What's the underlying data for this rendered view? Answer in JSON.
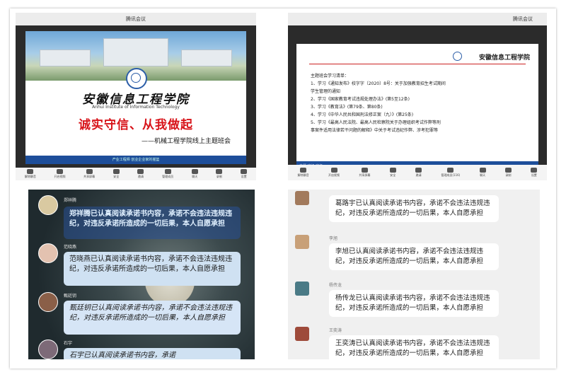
{
  "top_left": {
    "titlebar": "腾讯会议",
    "school_name": "安徽信息工程学院",
    "school_en": "Anhui Institute of Information Technology",
    "headline": "诚实守信、从我做起",
    "subtitle": "——机械工程学院线上主题班会",
    "slide_footer": "产业工程师  创业企业家的摇篮",
    "toolbar": [
      "解除静音",
      "开启视频",
      "共享屏幕",
      "安全",
      "邀请",
      "管理成员",
      "聊天",
      "录制",
      "设置"
    ]
  },
  "top_right": {
    "titlebar": "腾讯会议",
    "doc_header": "安徽信息工程学院",
    "doc_lines": [
      "主题班会学习清单：",
      "1、学习《通知发布》校字字〔2020〕8号：关于加强教育招生考试期间",
      "   学生管理的通知",
      "2、学习《国家教育考试违规处理办法》(第5至12条)",
      "3、学习《教育法》(第79条、第80条)",
      "4、学习《中华人民共和国刑法修正案（九）》(第25条)",
      "5、学习《最高人民法院、最高人民检察院关于办理组织考试作弊等刑",
      "   事案件适用法律若干问题的解释》中关于考试违纪作弊、涉考犯罪等"
    ],
    "doc_footer": "主题  班级  班级",
    "toolbar": [
      "解除静音",
      "开启视频",
      "共享屏幕",
      "安全",
      "邀请",
      "管理成员(116)",
      "聊天",
      "录制",
      "设置"
    ]
  },
  "bottom_left": {
    "messages": [
      {
        "name": "郑祥腾",
        "text": "郑祥腾已认真阅读承诺书内容，承诺不会违法违规违纪，对违反承诺所造成的一切后果，本人自愿承担"
      },
      {
        "name": "范晓燕",
        "text": "范晓燕已认真阅读承诺书内容，承诺不会违法违规违纪，对违反承诺所造成的一切后果，本人自愿承担"
      },
      {
        "name": "甄廷钥",
        "text": "甄廷钥已认真阅读承诺书内容，承诺不会违法违规违纪，对违反承诺所造成的一切后果，本人自愿承担"
      },
      {
        "name": "石宇",
        "text": "石宇已认真阅读承诺书内容，承诺"
      }
    ]
  },
  "bottom_right": {
    "messages": [
      {
        "name": "",
        "text": "葛路宇已认真阅读承诺书内容，承诺不会违法违规违纪，对违反承诺所造成的一切后果，本人自愿承担"
      },
      {
        "name": "李旭",
        "text": "李旭已认真阅读承诺书内容，承诺不会违法违规违纪，对违反承诺所造成的一切后果，本人自愿承担"
      },
      {
        "name": "杨传龙",
        "text": "杨传龙已认真阅读承诺书内容，承诺不会违法违规违纪，对违反承诺所造成的一切后果，本人自愿承担"
      },
      {
        "name": "王奕涛",
        "text": "王奕涛已认真阅读承诺书内容，承诺不会违法违规违纪，对违反承诺所造成的一切后果，本人自愿承担"
      }
    ]
  }
}
